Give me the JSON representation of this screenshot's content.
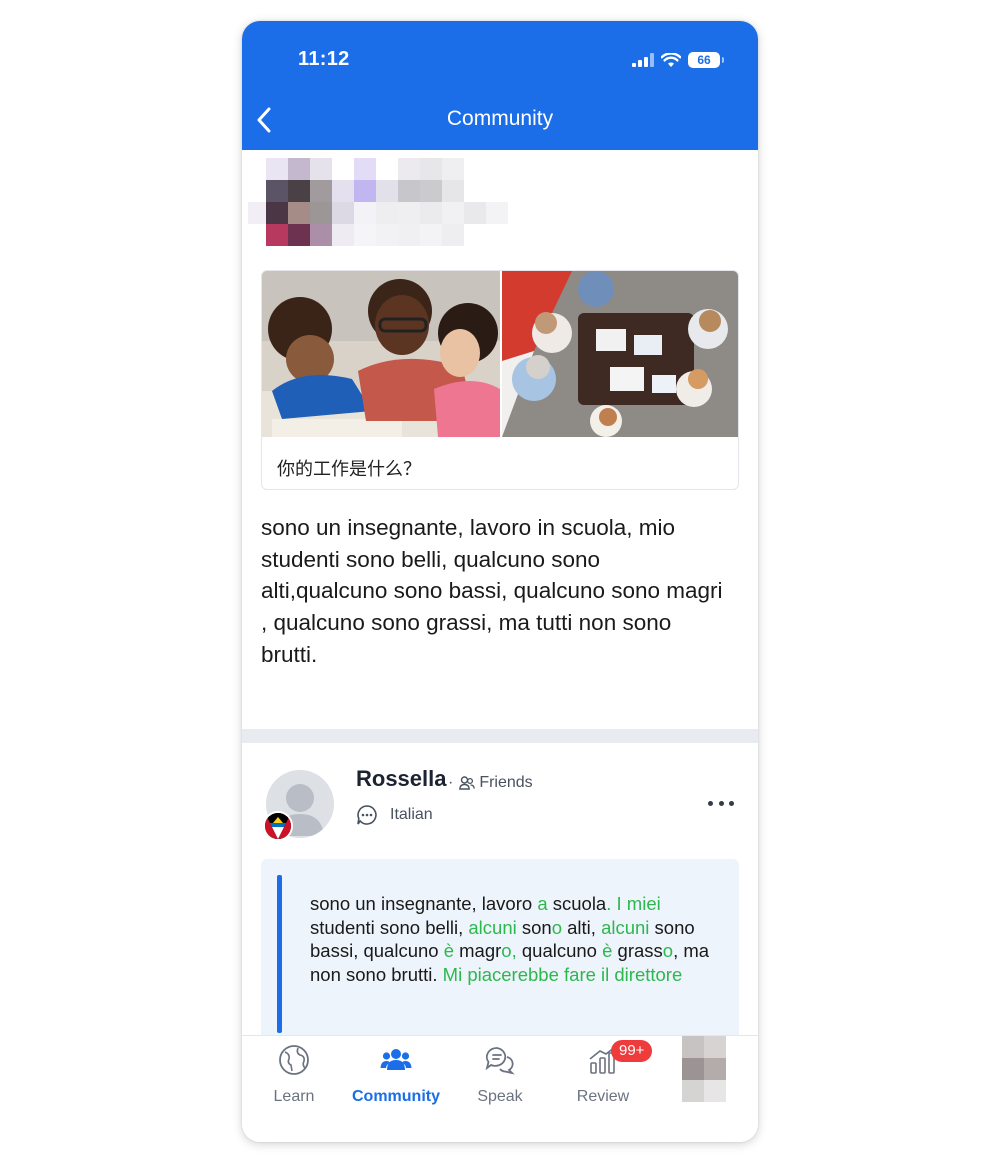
{
  "status_bar": {
    "time": "11:12",
    "battery": "66"
  },
  "header": {
    "title": "Community"
  },
  "prompt": {
    "question": "你的工作是什么？"
  },
  "post": {
    "body": "sono un insegnante, lavoro in scuola, mio studenti sono belli, qualcuno sono alti,qualcuno sono bassi, qualcuno sono magri , qualcuno sono grassi, ma tutti non sono brutti."
  },
  "comment": {
    "username": "Rossella",
    "relation": "Friends",
    "language": "Italian",
    "correction_segments": [
      {
        "text": "sono un insegnante, lavoro ",
        "changed": false
      },
      {
        "text": "a",
        "changed": true
      },
      {
        "text": " scuola",
        "changed": false
      },
      {
        "text": ". I miei",
        "changed": true
      },
      {
        "text": " studenti sono belli, ",
        "changed": false
      },
      {
        "text": "alcuni",
        "changed": true
      },
      {
        "text": " son",
        "changed": false
      },
      {
        "text": "o",
        "changed": true
      },
      {
        "text": " alti, ",
        "changed": false
      },
      {
        "text": "alcuni",
        "changed": true
      },
      {
        "text": " sono bassi, qualcuno ",
        "changed": false
      },
      {
        "text": "è",
        "changed": true
      },
      {
        "text": " magr",
        "changed": false
      },
      {
        "text": "o,",
        "changed": true
      },
      {
        "text": " qualcuno ",
        "changed": false
      },
      {
        "text": "è",
        "changed": true
      },
      {
        "text": " grass",
        "changed": false
      },
      {
        "text": "o",
        "changed": true
      },
      {
        "text": ", ma non sono brutti. ",
        "changed": false
      },
      {
        "text": "Mi piacerebbe fare il direttore",
        "changed": true
      }
    ]
  },
  "tabbar": {
    "tabs": [
      {
        "label": "Learn",
        "icon": "globe-icon",
        "active": false
      },
      {
        "label": "Community",
        "icon": "people-icon",
        "active": true
      },
      {
        "label": "Speak",
        "icon": "chat-bubbles-icon",
        "active": false
      },
      {
        "label": "Review",
        "icon": "bar-chart-icon",
        "active": false,
        "badge": "99+"
      }
    ]
  },
  "colors": {
    "brand": "#1b6ee8",
    "correction": "#2db84d",
    "badge": "#ef3b3b"
  }
}
